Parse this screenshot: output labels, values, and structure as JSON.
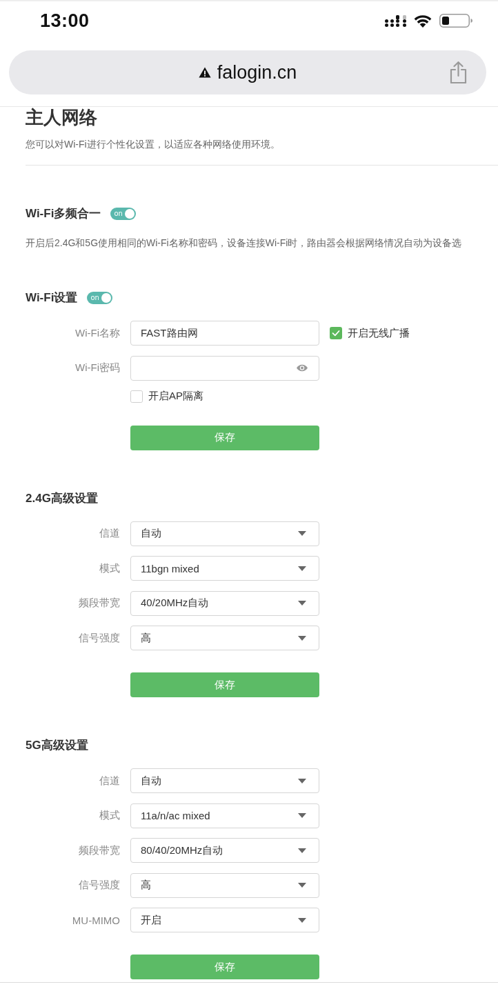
{
  "status_bar": {
    "time": "13:00"
  },
  "browser": {
    "url": "falogin.cn"
  },
  "page": {
    "title": "主人网络",
    "description": "您可以对Wi-Fi进行个性化设置，以适应各种网络使用环境。"
  },
  "sections": [
    {
      "title": "Wi-Fi多频合一",
      "switch": {
        "label": "on",
        "on": true
      },
      "note": "开启后2.4G和5G使用相同的Wi-Fi名称和密码，设备连接Wi-Fi时，路由器会根据网络情况自动为设备选"
    },
    {
      "title": "Wi-Fi设置",
      "switch": {
        "label": "on",
        "on": true
      },
      "fields": [
        {
          "kind": "text",
          "label": "Wi-Fi名称",
          "value": "FAST路由网",
          "checkbox": {
            "label": "开启无线广播",
            "checked": true
          }
        },
        {
          "kind": "password",
          "label": "Wi-Fi密码"
        }
      ],
      "checkboxes": [
        {
          "label": "开启AP隔离",
          "checked": false
        }
      ],
      "button": "保存"
    },
    {
      "title": "2.4G高级设置",
      "fields": [
        {
          "kind": "select",
          "label": "信道",
          "value": "自动"
        },
        {
          "kind": "select",
          "label": "模式",
          "value": "11bgn mixed"
        },
        {
          "kind": "select",
          "label": "频段带宽",
          "value": "40/20MHz自动"
        },
        {
          "kind": "select",
          "label": "信号强度",
          "value": "高"
        }
      ],
      "button": "保存"
    },
    {
      "title": "5G高级设置",
      "fields": [
        {
          "kind": "select",
          "label": "信道",
          "value": "自动"
        },
        {
          "kind": "select",
          "label": "模式",
          "value": "11a/n/ac mixed"
        },
        {
          "kind": "select",
          "label": "频段带宽",
          "value": "80/40/20MHz自动"
        },
        {
          "kind": "select",
          "label": "信号强度",
          "value": "高"
        },
        {
          "kind": "select",
          "label": "MU-MIMO",
          "value": "开启"
        }
      ],
      "button": "保存"
    }
  ]
}
